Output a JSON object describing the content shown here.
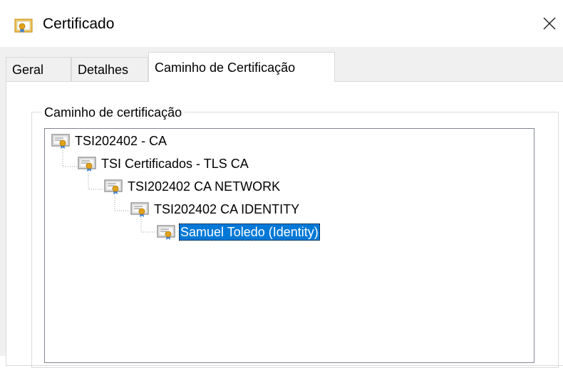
{
  "window": {
    "title": "Certificado",
    "icon": "certificate-icon",
    "close_glyph": "✕"
  },
  "tabs": [
    {
      "label": "Geral",
      "active": false
    },
    {
      "label": "Detalhes",
      "active": false
    },
    {
      "label": "Caminho de Certificação",
      "active": true
    }
  ],
  "cert_path": {
    "group_label": "Caminho de certificação",
    "nodes": [
      {
        "label": "TSI202402 - CA",
        "level": 0,
        "selected": false
      },
      {
        "label": "TSI Certificados - TLS CA",
        "level": 1,
        "selected": false
      },
      {
        "label": "TSI202402 CA NETWORK",
        "level": 2,
        "selected": false
      },
      {
        "label": "TSI202402 CA IDENTITY",
        "level": 3,
        "selected": false
      },
      {
        "label": "Samuel Toledo (Identity)",
        "level": 4,
        "selected": true
      }
    ]
  },
  "colors": {
    "selection": "#0078d7",
    "dialog_bg": "#f0f0f0",
    "cert_gold": "#e0a21a",
    "cert_blue": "#3c7fd6"
  }
}
